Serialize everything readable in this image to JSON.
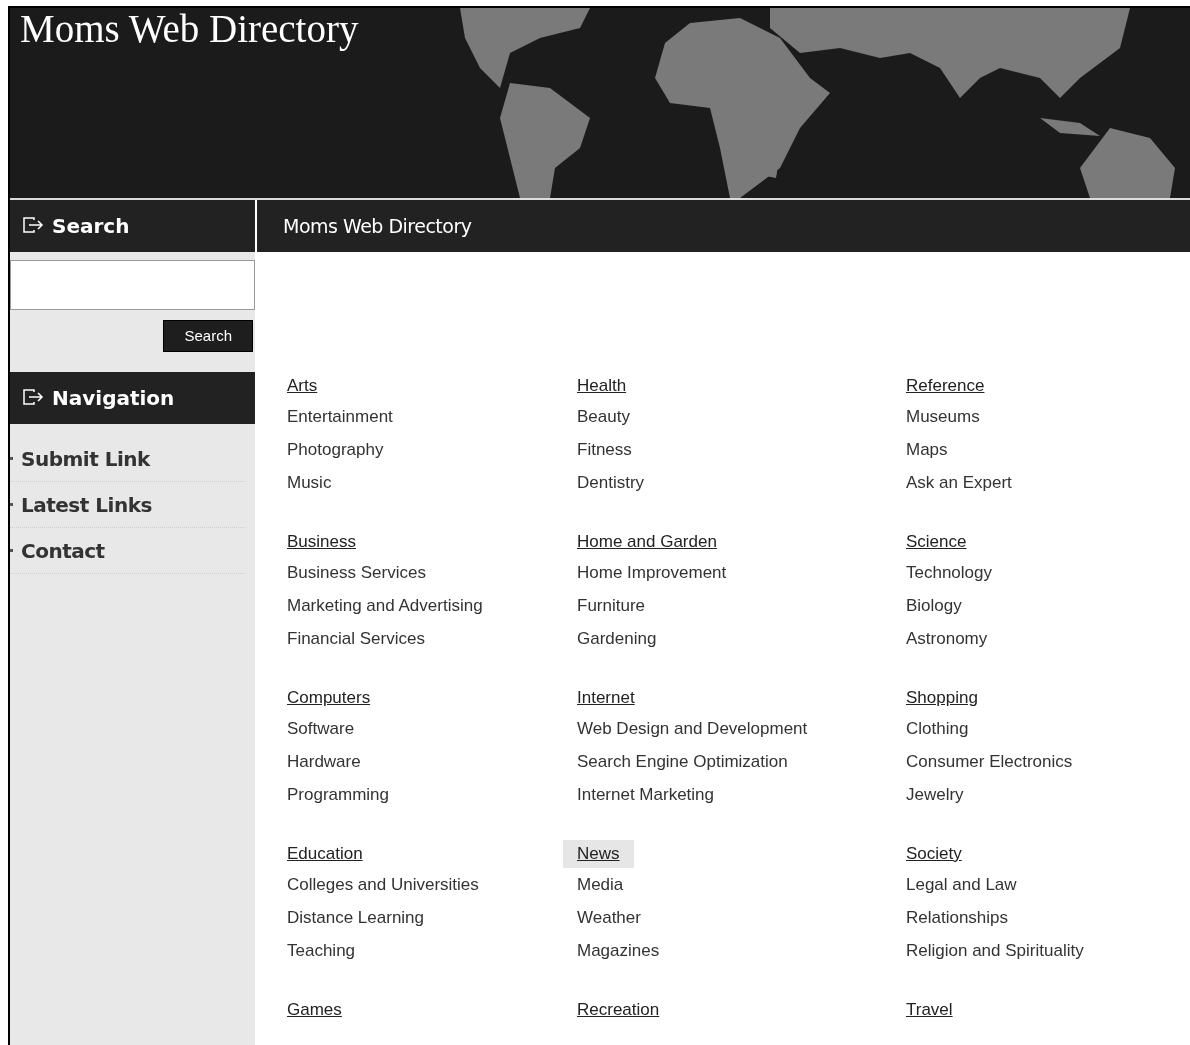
{
  "site_title": "Moms Web Directory",
  "sidebar": {
    "search_heading": "Search",
    "search_button": "Search",
    "nav_heading": "Navigation",
    "nav_items": [
      "Submit Link",
      "Latest Links",
      "Contact"
    ]
  },
  "content_title": "Moms Web Directory",
  "categories": [
    {
      "name": "Arts",
      "highlighted": false,
      "items": [
        "Entertainment",
        "Photography",
        "Music"
      ]
    },
    {
      "name": "Health",
      "highlighted": false,
      "items": [
        "Beauty",
        "Fitness",
        "Dentistry"
      ]
    },
    {
      "name": "Reference",
      "highlighted": false,
      "items": [
        "Museums",
        "Maps",
        "Ask an Expert"
      ]
    },
    {
      "name": "Business",
      "highlighted": false,
      "items": [
        "Business Services",
        "Marketing and Advertising",
        "Financial Services"
      ]
    },
    {
      "name": "Home and Garden",
      "highlighted": false,
      "items": [
        "Home Improvement",
        "Furniture",
        "Gardening"
      ]
    },
    {
      "name": "Science",
      "highlighted": false,
      "items": [
        "Technology",
        "Biology",
        "Astronomy"
      ]
    },
    {
      "name": "Computers",
      "highlighted": false,
      "items": [
        "Software",
        "Hardware",
        "Programming"
      ]
    },
    {
      "name": "Internet",
      "highlighted": false,
      "items": [
        "Web Design and Development",
        "Search Engine Optimization",
        "Internet Marketing"
      ]
    },
    {
      "name": "Shopping",
      "highlighted": false,
      "items": [
        "Clothing",
        "Consumer Electronics",
        "Jewelry"
      ]
    },
    {
      "name": "Education",
      "highlighted": false,
      "items": [
        "Colleges and Universities",
        "Distance Learning",
        "Teaching"
      ]
    },
    {
      "name": "News",
      "highlighted": true,
      "items": [
        "Media",
        "Weather",
        "Magazines"
      ]
    },
    {
      "name": "Society",
      "highlighted": false,
      "items": [
        "Legal and Law",
        "Relationships",
        "Religion and Spirituality"
      ]
    },
    {
      "name": "Games",
      "highlighted": false
    },
    {
      "name": "Recreation",
      "highlighted": false
    },
    {
      "name": "Travel",
      "highlighted": false
    }
  ]
}
